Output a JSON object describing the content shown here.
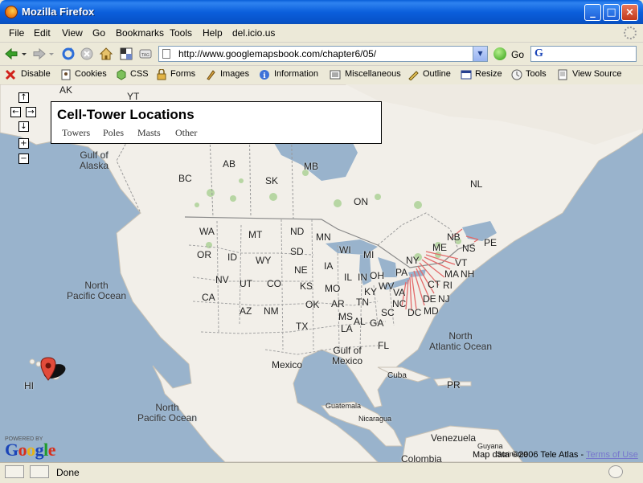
{
  "window": {
    "title": "Mozilla Firefox"
  },
  "menu": [
    "File",
    "Edit",
    "View",
    "Go",
    "Bookmarks",
    "Tools",
    "Help",
    "del.icio.us"
  ],
  "nav": {
    "url": "http://www.googlemapsbook.com/chapter6/05/",
    "go_label": "Go"
  },
  "devbar": {
    "items": [
      "Disable",
      "Cookies",
      "CSS",
      "Forms",
      "Images",
      "Information",
      "Miscellaneous",
      "Outline",
      "Resize",
      "Tools",
      "View Source"
    ]
  },
  "panel": {
    "title": "Cell-Tower Locations",
    "tabs": [
      "Towers",
      "Poles",
      "Masts",
      "Other"
    ]
  },
  "map": {
    "labels": {
      "ak": "AK",
      "yt": "YT",
      "gulf_alaska": "Gulf of\nAlaska",
      "bc": "BC",
      "ab": "AB",
      "sk": "SK",
      "mb": "MB",
      "on": "ON",
      "nl": "NL",
      "nb": "NB",
      "pe": "PE",
      "ns": "NS",
      "wa": "WA",
      "mt": "MT",
      "nd": "ND",
      "mn": "MN",
      "wi": "WI",
      "mi": "MI",
      "or": "OR",
      "id": "ID",
      "wy": "WY",
      "sd": "SD",
      "ia": "IA",
      "ne": "NE",
      "nv": "NV",
      "ut": "UT",
      "co": "CO",
      "ks": "KS",
      "mo": "MO",
      "il": "IL",
      "in": "IN",
      "oh": "OH",
      "ca": "CA",
      "az": "AZ",
      "nm": "NM",
      "ok": "OK",
      "ar": "AR",
      "tn": "TN",
      "ky": "KY",
      "wv": "WV",
      "tx": "TX",
      "ms": "MS",
      "al": "AL",
      "ga": "GA",
      "la": "LA",
      "sc": "SC",
      "nc": "NC",
      "fl": "FL",
      "va": "VA",
      "pa": "PA",
      "ny": "NY",
      "vt": "VT",
      "me": "ME",
      "nh": "NH",
      "ma": "MA",
      "ct": "CT",
      "ri": "RI",
      "nj": "NJ",
      "de": "DE",
      "md": "MD",
      "dc": "DC",
      "hi": "HI",
      "north_pacific": "North\nPacific Ocean",
      "north_pacific_2": "North\nPacific Ocean",
      "north_atlantic": "North\nAtlantic Ocean",
      "gulf_mexico": "Gulf of\nMexico",
      "mexico": "Mexico",
      "cuba": "Cuba",
      "pr": "PR",
      "guatemala": "Guatemala",
      "nicaragua": "Nicaragua",
      "venezuela": "Venezuela",
      "guyana": "Guyana",
      "suriname": "Suriname",
      "colombia": "Colombia"
    },
    "google_powered": "POWERED BY",
    "google_word": "Google",
    "map_data": "Map data ©2006 Tele Atlas - ",
    "terms": "Terms of Use"
  },
  "status": {
    "text": "Done"
  }
}
